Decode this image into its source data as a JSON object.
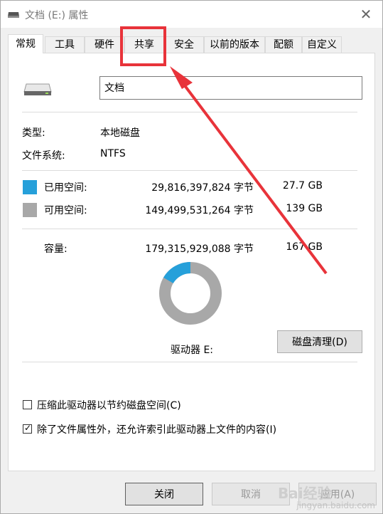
{
  "window": {
    "title": "文档 (E:) 属性",
    "close_glyph": "✕"
  },
  "tabs": [
    {
      "label": "常规",
      "active": true
    },
    {
      "label": "工具"
    },
    {
      "label": "硬件"
    },
    {
      "label": "共享"
    },
    {
      "label": "安全"
    },
    {
      "label": "以前的版本"
    },
    {
      "label": "配额"
    },
    {
      "label": "自定义"
    }
  ],
  "general": {
    "drive_name": "文档",
    "type_label": "类型:",
    "type_value": "本地磁盘",
    "fs_label": "文件系统:",
    "fs_value": "NTFS",
    "used": {
      "label": "已用空间:",
      "bytes": "29,816,397,824 字节",
      "size": "27.7 GB",
      "color": "#26a0da"
    },
    "free": {
      "label": "可用空间:",
      "bytes": "149,499,531,264 字节",
      "size": "139 GB",
      "color": "#a8a8a8"
    },
    "capacity": {
      "label": "容量:",
      "bytes": "179,315,929,088 字节",
      "size": "167 GB"
    },
    "drive_label": "驱动器 E:",
    "cleanup_button": "磁盘清理(D)",
    "compress_label": "压缩此驱动器以节约磁盘空间(C)",
    "compress_checked": false,
    "index_label": "除了文件属性外，还允许索引此驱动器上文件的内容(I)",
    "index_checked": true,
    "used_fraction": 0.166
  },
  "footer": {
    "close_button": "关闭",
    "cancel_button": "取消",
    "apply_button": "应用(A)"
  },
  "watermark": {
    "text": "Bai经验",
    "sub": "jingyan.baidu.com"
  },
  "colors": {
    "annotation": "#e8333a",
    "accent": "#26a0da"
  }
}
